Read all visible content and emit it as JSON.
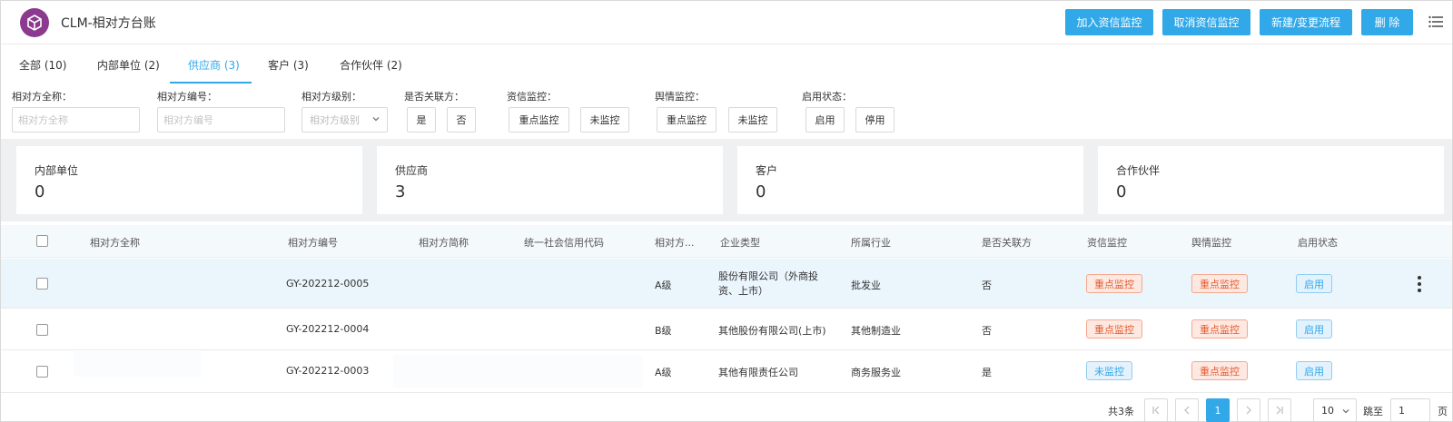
{
  "header": {
    "title": "CLM-相对方台账",
    "buttons": [
      "加入资信监控",
      "取消资信监控",
      "新建/变更流程",
      "删 除"
    ]
  },
  "tabs": [
    {
      "label": "全部 (10)"
    },
    {
      "label": "内部单位 (2)"
    },
    {
      "label": "供应商 (3)"
    },
    {
      "label": "客户 (3)"
    },
    {
      "label": "合作伙伴 (2)"
    }
  ],
  "filters": {
    "full_name": {
      "label": "相对方全称：",
      "placeholder": "相对方全称"
    },
    "code": {
      "label": "相对方编号：",
      "placeholder": "相对方编号"
    },
    "level": {
      "label": "相对方级别：",
      "placeholder": "相对方级别"
    },
    "related": {
      "label": "是否关联方：",
      "options": [
        "是",
        "否"
      ]
    },
    "credit": {
      "label": "资信监控：",
      "options": [
        "重点监控",
        "未监控"
      ]
    },
    "opinion": {
      "label": "舆情监控：",
      "options": [
        "重点监控",
        "未监控"
      ]
    },
    "status": {
      "label": "启用状态：",
      "options": [
        "启用",
        "停用"
      ]
    }
  },
  "stats": [
    {
      "label": "内部单位",
      "value": "0"
    },
    {
      "label": "供应商",
      "value": "3"
    },
    {
      "label": "客户",
      "value": "0"
    },
    {
      "label": "合作伙伴",
      "value": "0"
    }
  ],
  "table": {
    "columns": [
      "相对方全称",
      "相对方编号",
      "相对方简称",
      "统一社会信用代码",
      "相对方...",
      "企业类型",
      "所属行业",
      "是否关联方",
      "资信监控",
      "舆情监控",
      "启用状态"
    ],
    "rows": [
      {
        "code": "GY-202212-0005",
        "level": "A级",
        "type": "股份有限公司（外商投资、上市）",
        "industry": "批发业",
        "related": "否",
        "credit": "重点监控",
        "opinion": "重点监控",
        "status": "启用"
      },
      {
        "code": "GY-202212-0004",
        "level": "B级",
        "type": "其他股份有限公司(上市)",
        "industry": "其他制造业",
        "related": "否",
        "credit": "重点监控",
        "opinion": "重点监控",
        "status": "启用"
      },
      {
        "code": "GY-202212-0003",
        "level": "A级",
        "type": "其他有限责任公司",
        "industry": "商务服务业",
        "related": "是",
        "credit": "未监控",
        "opinion": "重点监控",
        "status": "启用"
      }
    ]
  },
  "pagination": {
    "total": "共3条",
    "current": "1",
    "page_size": "10",
    "jump_label": "跳至",
    "jump_value": "1",
    "page_label": "页"
  },
  "colors": {
    "accent": "#31a8e8",
    "brand": "#8b3a8f",
    "tag_red": "#e55b2d"
  },
  "icons": [
    "cube-logo-icon",
    "menu-list-icon",
    "chevron-down-icon",
    "first-page-icon",
    "prev-page-icon",
    "next-page-icon",
    "last-page-icon",
    "kebab-menu-icon"
  ]
}
